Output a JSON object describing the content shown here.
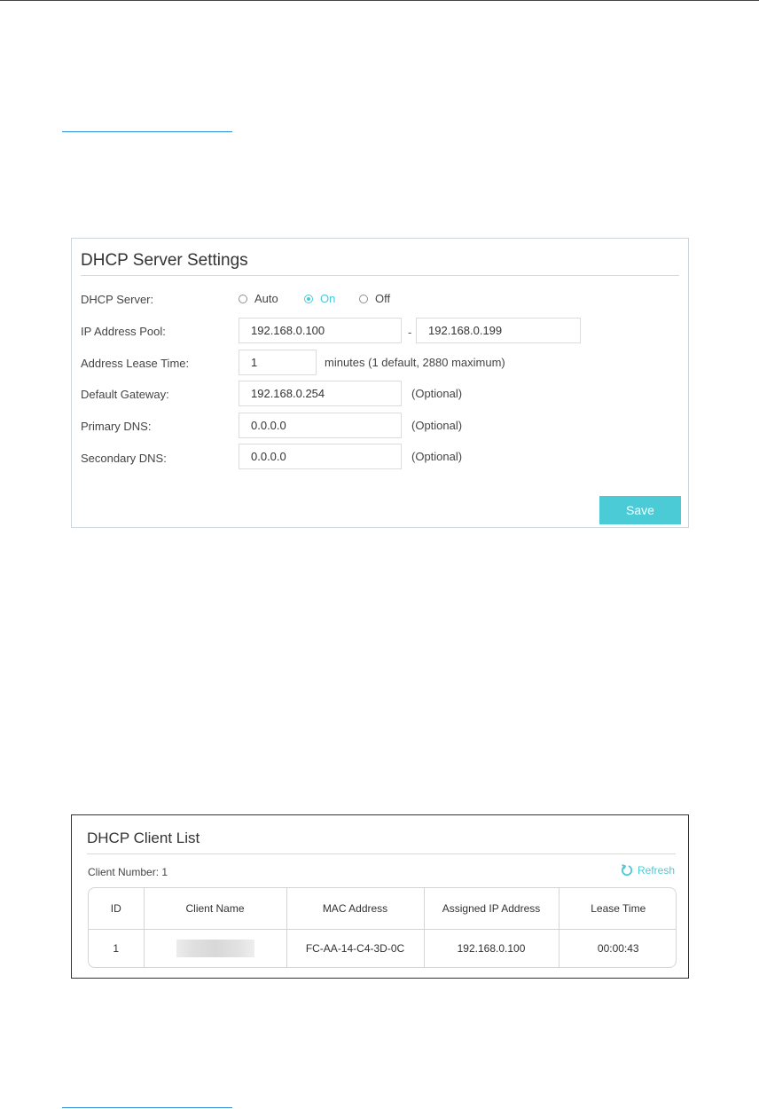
{
  "dhcp_settings": {
    "title": "DHCP Server Settings",
    "server_label": "DHCP Server:",
    "server_options": [
      "Auto",
      "On",
      "Off"
    ],
    "server_selected": "On",
    "ip_pool_label": "IP Address Pool:",
    "ip_pool_start": "192.168.0.100",
    "ip_pool_separator": "-",
    "ip_pool_end": "192.168.0.199",
    "lease_time_label": "Address Lease Time:",
    "lease_time_value": "1",
    "lease_time_note": "minutes (1 default, 2880 maximum)",
    "gateway_label": "Default Gateway:",
    "gateway_value": "192.168.0.254",
    "primary_dns_label": "Primary DNS:",
    "primary_dns_value": "0.0.0.0",
    "secondary_dns_label": "Secondary DNS:",
    "secondary_dns_value": "0.0.0.0",
    "optional_note": "(Optional)",
    "save_label": "Save",
    "accent_color": "#4acbd6"
  },
  "client_list": {
    "title": "DHCP Client List",
    "client_number": "Client Number: 1",
    "refresh_label": "Refresh",
    "columns": [
      "ID",
      "Client Name",
      "MAC Address",
      "Assigned IP Address",
      "Lease Time"
    ],
    "rows": [
      {
        "id": "1",
        "client_name": "",
        "mac": "FC-AA-14-C4-3D-0C",
        "ip": "192.168.0.100",
        "lease": "00:00:43"
      }
    ]
  }
}
